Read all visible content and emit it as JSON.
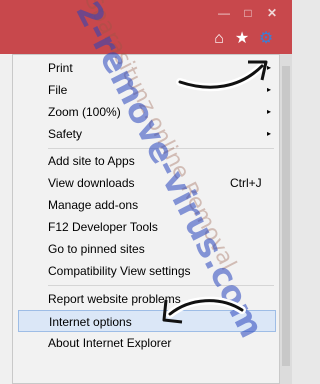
{
  "window": {
    "minimize": "—",
    "maximize": "□",
    "close": "✕",
    "toolbar": {
      "home_icon": "⌂",
      "star_icon": "★",
      "gear_icon": "⚙"
    }
  },
  "menu": {
    "items": [
      {
        "label": "Print",
        "has_arrow": "▸"
      },
      {
        "label": "File",
        "has_arrow": "▸"
      },
      {
        "label": "Zoom (100%)",
        "has_arrow": "▸"
      },
      {
        "label": "Safety",
        "has_arrow": "▸"
      },
      {
        "label": "Add site to Apps"
      },
      {
        "label": "View downloads",
        "shortcut": "Ctrl+J"
      },
      {
        "label": "Manage add-ons"
      },
      {
        "label": "F12 Developer Tools"
      },
      {
        "label": "Go to pinned sites"
      },
      {
        "label": "Compatibility View settings"
      },
      {
        "label": "Report website problems"
      },
      {
        "label": "Internet options"
      },
      {
        "label": "About Internet Explorer"
      }
    ]
  },
  "watermark": {
    "main": "2-remove-virus.com",
    "secondary": "Sparasitunz.online Removal"
  },
  "colors": {
    "titlebar": "#c8484c",
    "highlight": "#dbe7f7",
    "gear": "#3a7ed6"
  }
}
